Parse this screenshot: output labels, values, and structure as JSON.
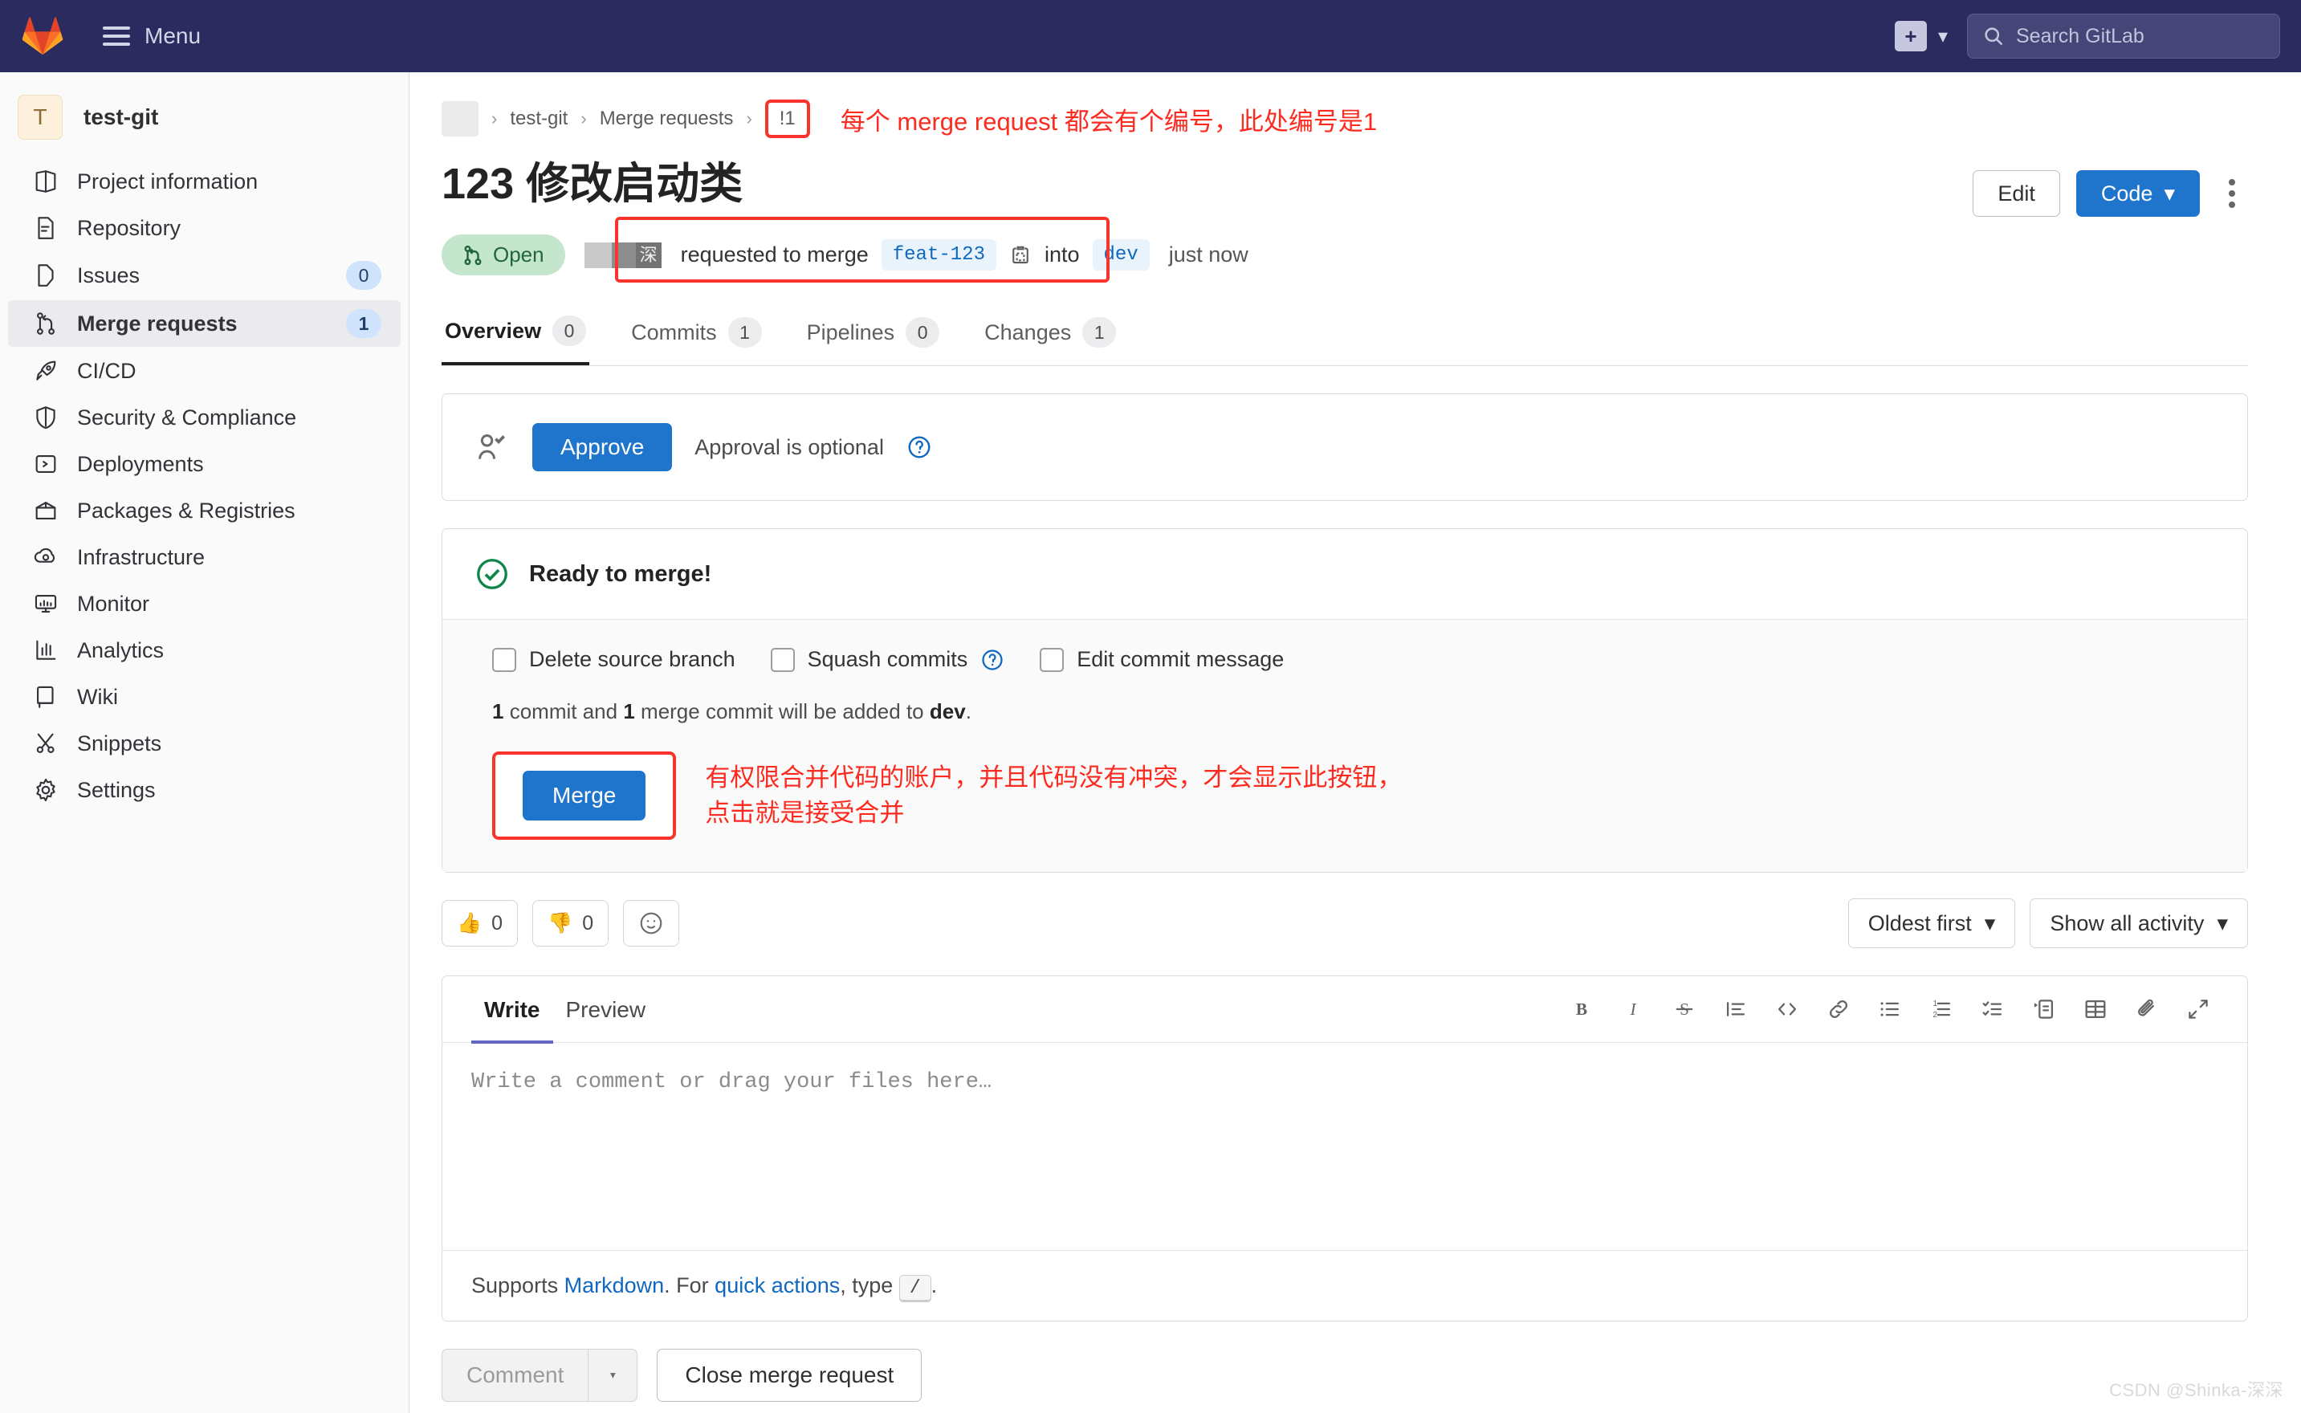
{
  "topbar": {
    "logo_icon": "gitlab-logo-icon",
    "menu_label": "Menu",
    "plus_icon": "plus-icon",
    "caret_icon": "chevron-down-icon",
    "search_icon": "search-icon",
    "search_placeholder": "Search GitLab"
  },
  "sidebar": {
    "project_initial": "T",
    "project_name": "test-git",
    "items": [
      {
        "label": "Project information",
        "icon": "project-info-icon",
        "badge": "",
        "active": false
      },
      {
        "label": "Repository",
        "icon": "repository-icon",
        "badge": "",
        "active": false
      },
      {
        "label": "Issues",
        "icon": "issues-icon",
        "badge": "0",
        "active": false
      },
      {
        "label": "Merge requests",
        "icon": "merge-request-icon",
        "badge": "1",
        "active": true
      },
      {
        "label": "CI/CD",
        "icon": "rocket-icon",
        "badge": "",
        "active": false
      },
      {
        "label": "Security & Compliance",
        "icon": "shield-icon",
        "badge": "",
        "active": false
      },
      {
        "label": "Deployments",
        "icon": "deployments-icon",
        "badge": "",
        "active": false
      },
      {
        "label": "Packages & Registries",
        "icon": "package-icon",
        "badge": "",
        "active": false
      },
      {
        "label": "Infrastructure",
        "icon": "infrastructure-icon",
        "badge": "",
        "active": false
      },
      {
        "label": "Monitor",
        "icon": "monitor-icon",
        "badge": "",
        "active": false
      },
      {
        "label": "Analytics",
        "icon": "analytics-icon",
        "badge": "",
        "active": false
      },
      {
        "label": "Wiki",
        "icon": "wiki-icon",
        "badge": "",
        "active": false
      },
      {
        "label": "Snippets",
        "icon": "snippets-icon",
        "badge": "",
        "active": false
      },
      {
        "label": "Settings",
        "icon": "gear-icon",
        "badge": "",
        "active": false
      }
    ]
  },
  "breadcrumb": {
    "project": "test-git",
    "section": "Merge requests",
    "mr_id": "!1",
    "separator": "›",
    "annotation": "每个 merge request 都会有个编号，此处编号是1"
  },
  "header": {
    "title": "123 修改启动类",
    "edit_label": "Edit",
    "code_label": "Code",
    "kebab_icon": "ellipsis-vertical-icon"
  },
  "status": {
    "state_label": "Open",
    "state_icon": "merge-request-icon",
    "author_masked": "深",
    "requested_text": "requested to merge",
    "source_branch": "feat-123",
    "copy_icon": "copy-icon",
    "into_text": "into",
    "target_branch": "dev",
    "time_text": "just now"
  },
  "tabs": [
    {
      "label": "Overview",
      "count": "0",
      "active": true
    },
    {
      "label": "Commits",
      "count": "1",
      "active": false
    },
    {
      "label": "Pipelines",
      "count": "0",
      "active": false
    },
    {
      "label": "Changes",
      "count": "1",
      "active": false
    }
  ],
  "approval": {
    "icon": "user-check-icon",
    "button_label": "Approve",
    "note": "Approval is optional",
    "help_icon": "question-circle-icon"
  },
  "merge_widget": {
    "ready_icon": "check-circle-icon",
    "ready_text": "Ready to merge!",
    "checkboxes": [
      {
        "label": "Delete source branch",
        "checked": false,
        "help": false
      },
      {
        "label": "Squash commits",
        "checked": false,
        "help": true
      },
      {
        "label": "Edit commit message",
        "checked": false,
        "help": false
      }
    ],
    "commit_note_a": "1",
    "commit_note_b": "commit and",
    "commit_note_c": "1",
    "commit_note_d": "merge commit will be added to",
    "commit_note_branch": "dev",
    "commit_note_end": ".",
    "merge_button_label": "Merge",
    "annotation": "有权限合并代码的账户，并且代码没有冲突，才会显示此按钮，\n点击就是接受合并"
  },
  "reactions": {
    "thumbs_up_icon": "thumbs-up-icon",
    "thumbs_up_count": "0",
    "thumbs_down_icon": "thumbs-down-icon",
    "thumbs_down_count": "0",
    "emoji_icon": "smiley-icon",
    "sort_label": "Oldest first",
    "filter_label": "Show all activity"
  },
  "editor": {
    "tab_write": "Write",
    "tab_preview": "Preview",
    "placeholder": "Write a comment or drag your files here…",
    "toolbar": [
      {
        "icon": "bold-icon",
        "glyph": "B"
      },
      {
        "icon": "italic-icon",
        "glyph": "I"
      },
      {
        "icon": "strikethrough-icon",
        "glyph": "S"
      },
      {
        "icon": "quote-icon",
        "glyph": "”"
      },
      {
        "icon": "code-icon",
        "glyph": "</>"
      },
      {
        "icon": "link-icon",
        "glyph": "🔗"
      },
      {
        "icon": "bulleted-list-icon",
        "glyph": "☰"
      },
      {
        "icon": "numbered-list-icon",
        "glyph": "1."
      },
      {
        "icon": "task-list-icon",
        "glyph": "✓"
      },
      {
        "icon": "collapsible-section-icon",
        "glyph": "▸"
      },
      {
        "icon": "table-icon",
        "glyph": "▦"
      },
      {
        "icon": "attachment-icon",
        "glyph": "📎"
      },
      {
        "icon": "fullscreen-icon",
        "glyph": "⤡"
      }
    ],
    "footer_prefix": "Supports",
    "footer_markdown": "Markdown",
    "footer_mid": ". For",
    "footer_quick_actions": "quick actions",
    "footer_type": ", type",
    "footer_key": "/",
    "footer_end": "."
  },
  "bottom": {
    "comment_label": "Comment",
    "comment_caret_icon": "chevron-down-icon",
    "close_label": "Close merge request"
  },
  "watermark": "CSDN @Shinka-深深",
  "colors": {
    "nav_bg": "#2b2b5f",
    "primary_blue": "#1f75cb",
    "annotation_red": "#fb2b20",
    "open_green": "#24663b",
    "link_blue": "#1068bf"
  }
}
